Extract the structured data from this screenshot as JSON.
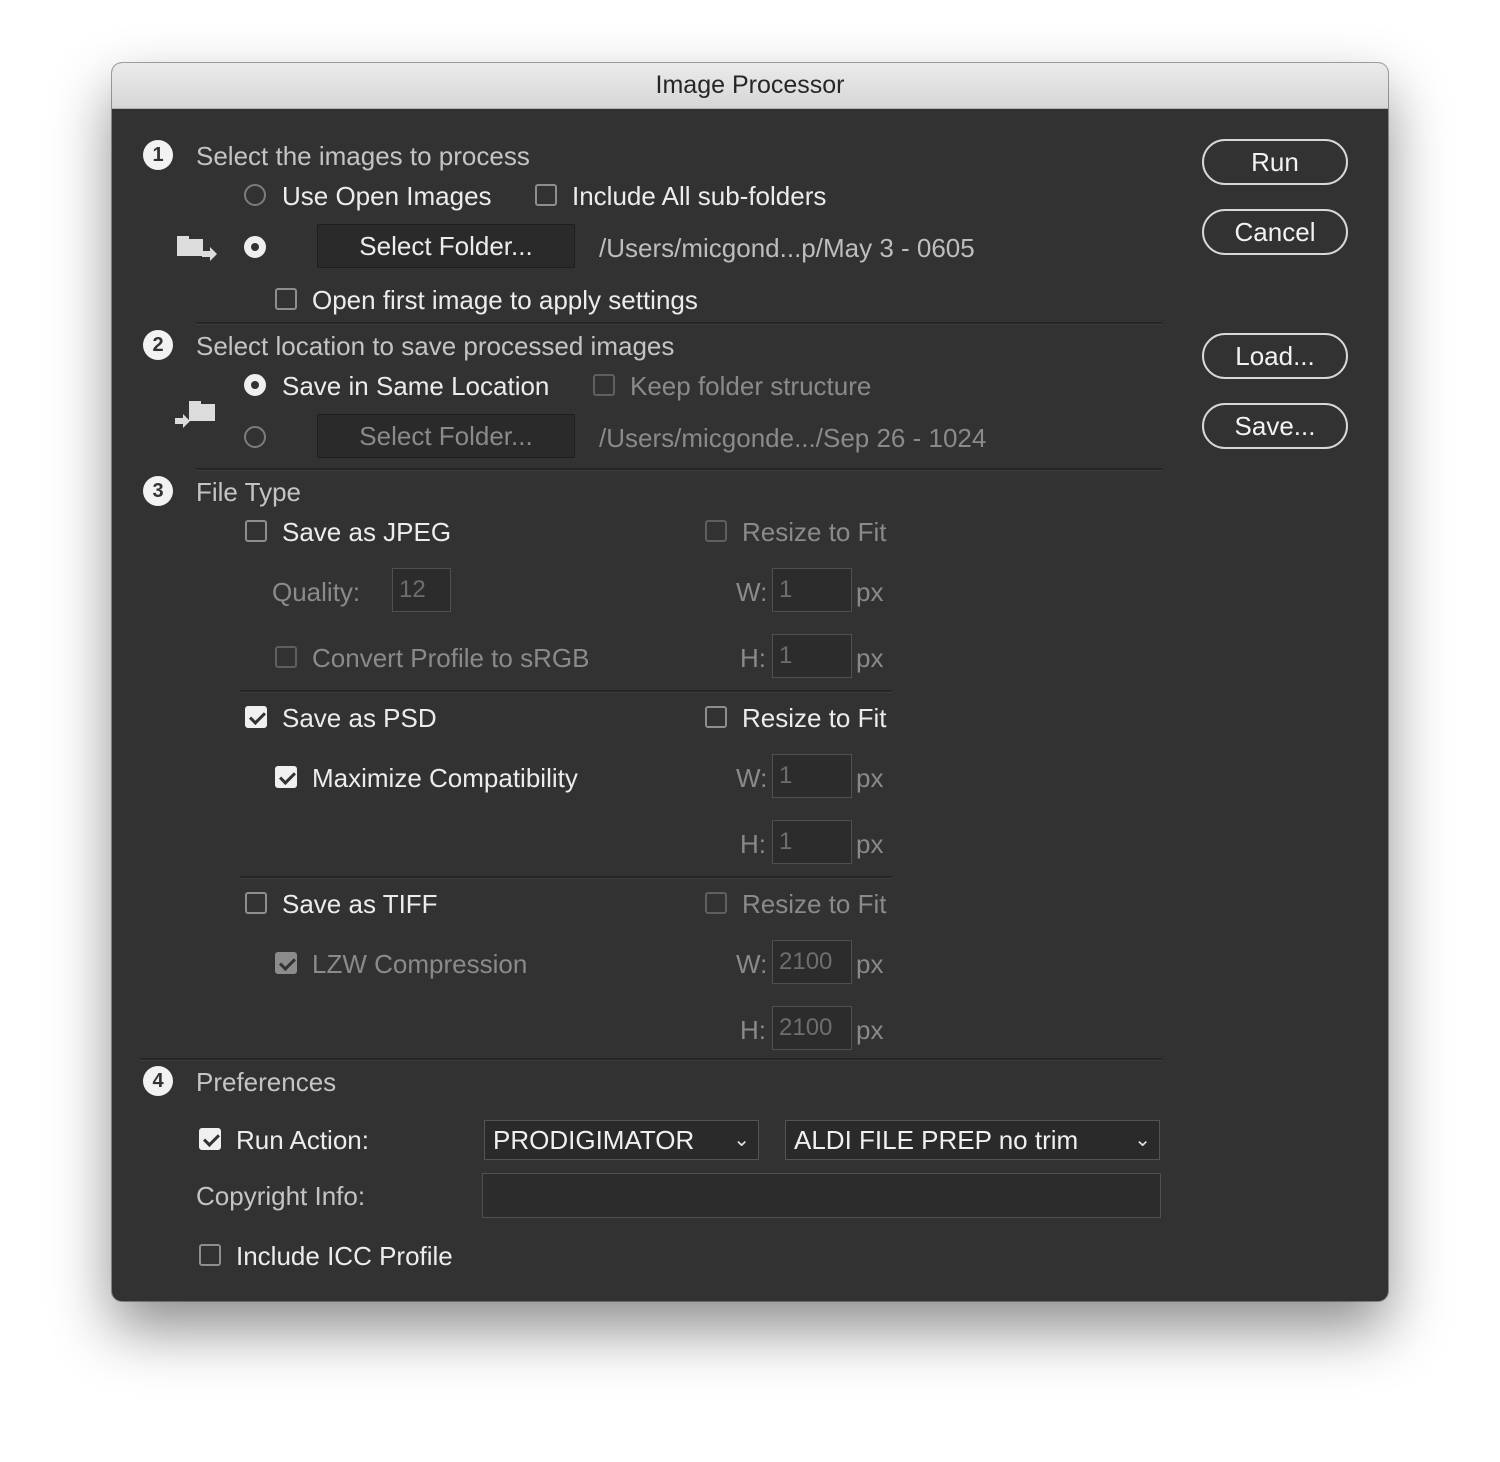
{
  "window": {
    "title": "Image Processor"
  },
  "buttons": {
    "run": "Run",
    "cancel": "Cancel",
    "load": "Load...",
    "save": "Save..."
  },
  "step1": {
    "number": "1",
    "heading": "Select the images to process",
    "use_open_images": "Use Open Images",
    "include_subfolders": "Include All sub-folders",
    "select_folder": "Select Folder...",
    "folder_path": "/Users/micgond...p/May 3 - 0605",
    "open_first_image": "Open first image to apply settings",
    "selected_source": "folder"
  },
  "step2": {
    "number": "2",
    "heading": "Select location to save processed images",
    "save_same_location": "Save in Same Location",
    "keep_folder_structure": "Keep folder structure",
    "select_folder": "Select Folder...",
    "folder_path": "/Users/micgonde.../Sep 26 - 1024",
    "selected_destination": "same-location"
  },
  "step3": {
    "number": "3",
    "heading": "File Type",
    "jpeg": {
      "label": "Save as JPEG",
      "checked": false,
      "quality_label": "Quality:",
      "quality_value": "12",
      "convert_profile": "Convert Profile to sRGB",
      "resize": "Resize to Fit",
      "w_label": "W:",
      "w_value": "1",
      "h_label": "H:",
      "h_value": "1",
      "unit": "px"
    },
    "psd": {
      "label": "Save as PSD",
      "checked": true,
      "maximize": "Maximize Compatibility",
      "maximize_checked": true,
      "resize": "Resize to Fit",
      "w_label": "W:",
      "w_value": "1",
      "h_label": "H:",
      "h_value": "1",
      "unit": "px"
    },
    "tiff": {
      "label": "Save as TIFF",
      "checked": false,
      "lzw": "LZW Compression",
      "lzw_checked": true,
      "resize": "Resize to Fit",
      "w_label": "W:",
      "w_value": "2100",
      "h_label": "H:",
      "h_value": "2100",
      "unit": "px"
    }
  },
  "step4": {
    "number": "4",
    "heading": "Preferences",
    "run_action": "Run Action:",
    "run_action_checked": true,
    "action_set": "PRODIGIMATOR",
    "action_name": "ALDI FILE PREP no trim",
    "copyright_label": "Copyright Info:",
    "copyright_value": "",
    "include_icc": "Include ICC Profile",
    "include_icc_checked": false
  }
}
